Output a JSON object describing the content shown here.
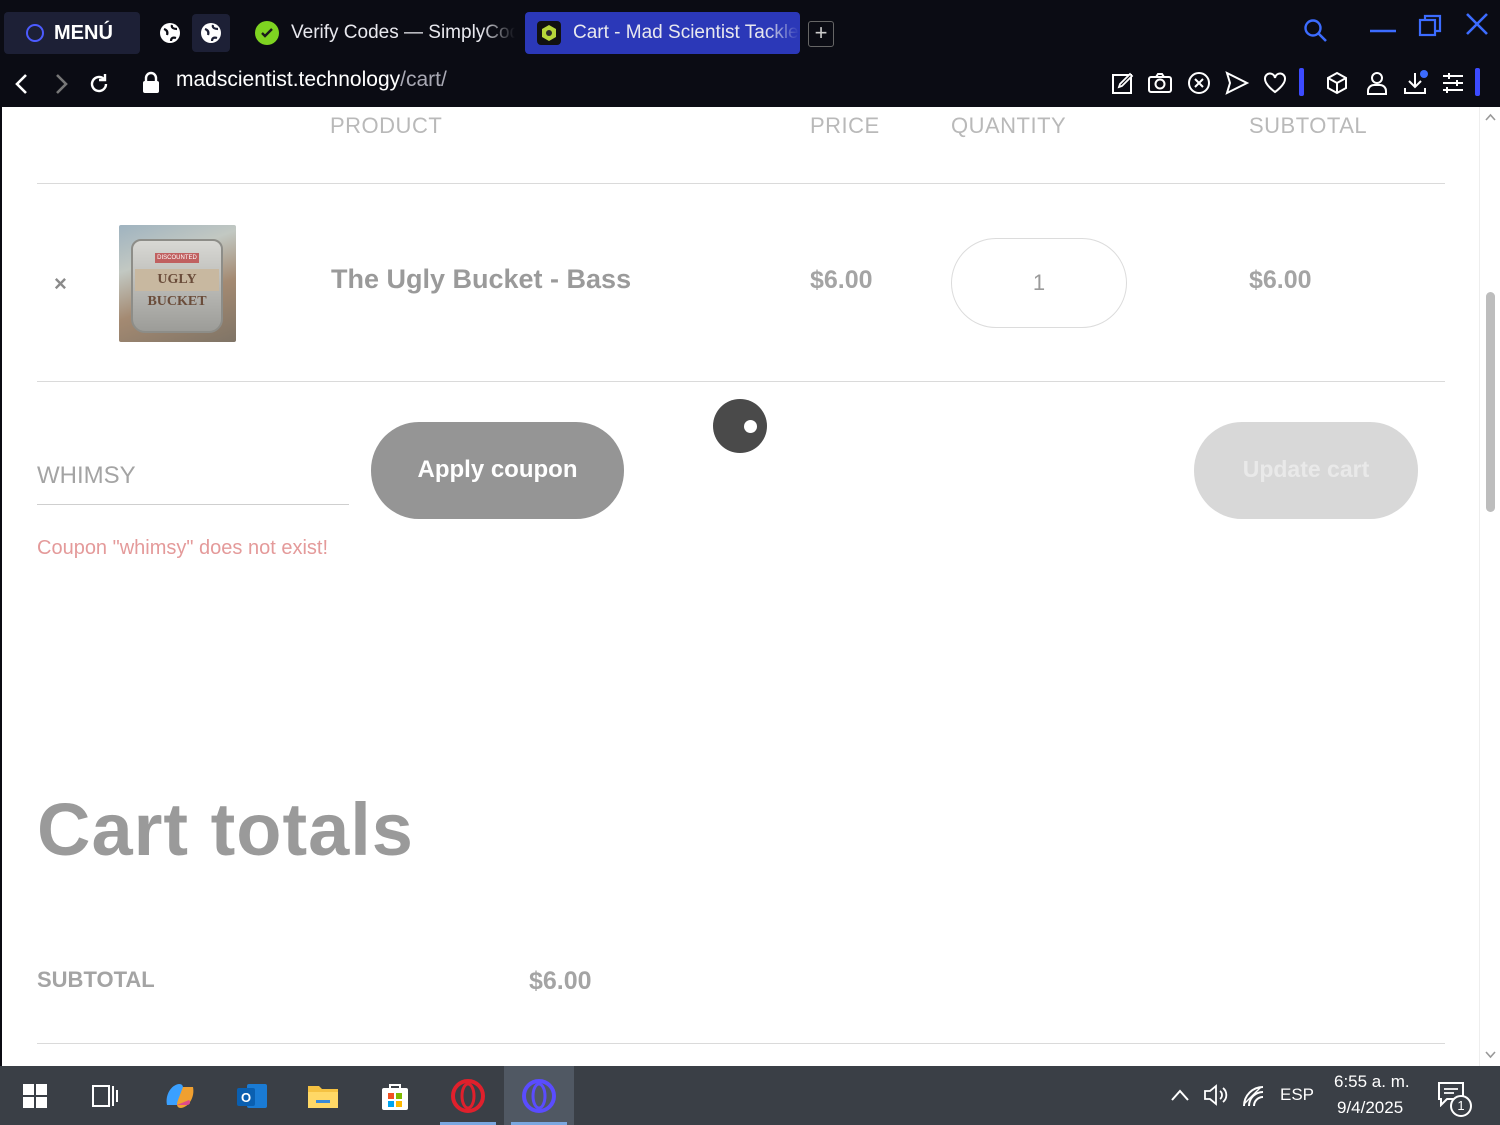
{
  "browser": {
    "menu_label": "MENÚ",
    "tabs": [
      {
        "title": "Verify Codes — SimplyCodes",
        "active": false
      },
      {
        "title": "Cart - Mad Scientist Tackle",
        "active": true
      }
    ],
    "new_tab_label": "+",
    "url_host": "madscientist.technology",
    "url_path": "/cart/"
  },
  "cart": {
    "headers": {
      "product": "PRODUCT",
      "price": "PRICE",
      "quantity": "QUANTITY",
      "subtotal": "SUBTOTAL"
    },
    "items": [
      {
        "remove_label": "×",
        "name": "The Ugly Bucket - Bass",
        "price": "$6.00",
        "quantity": "1",
        "subtotal": "$6.00",
        "image_text": "UGLY BUCKET",
        "image_tag": "DISCOUNTED"
      }
    ],
    "coupon_value": "WHIMSY",
    "apply_coupon_label": "Apply coupon",
    "update_cart_label": "Update cart",
    "coupon_error": "Coupon \"whimsy\" does not exist!"
  },
  "totals": {
    "title": "Cart totals",
    "subtotal_label": "SUBTOTAL",
    "subtotal_value": "$6.00"
  },
  "taskbar": {
    "language": "ESP",
    "time": "6:55 a. m.",
    "date": "9/4/2025",
    "notification_count": "1"
  },
  "colors": {
    "accent": "#2b38b8",
    "error": "#e49a9a",
    "button_gray": "#959595"
  }
}
